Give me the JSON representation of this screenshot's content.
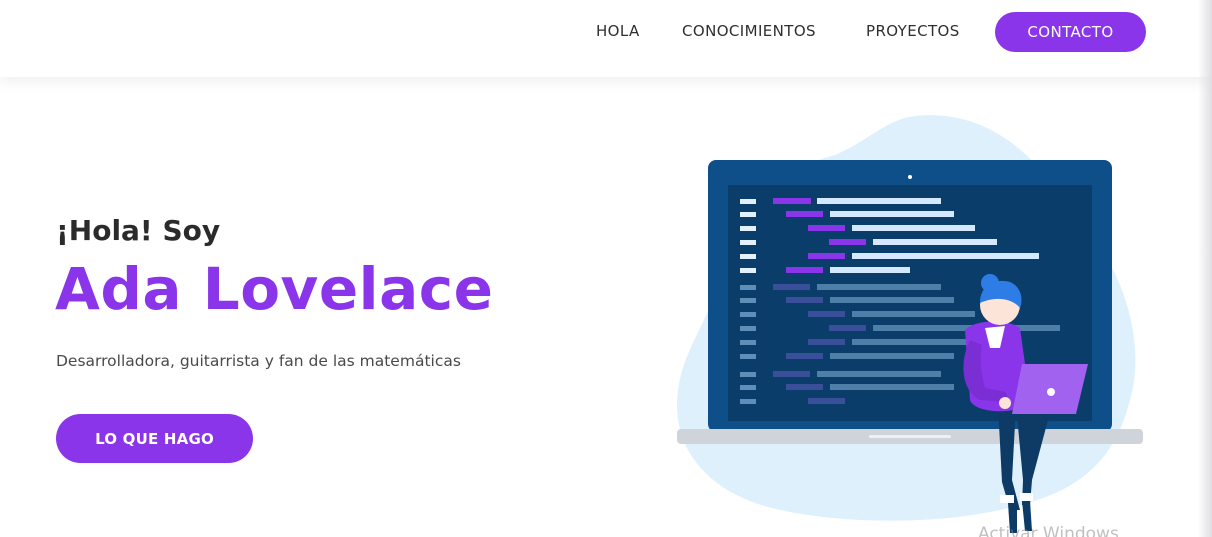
{
  "nav": {
    "links": [
      "HOLA",
      "CONOCIMIENTOS",
      "PROYECTOS"
    ],
    "cta_label": "CONTACTO"
  },
  "hero": {
    "greeting": "¡Hola! Soy",
    "name": "Ada Lovelace",
    "tagline": "Desarrolladora, guitarrista y fan de las matemáticas",
    "button_label": "LO QUE HAGO"
  },
  "illustration": {
    "icon": "developer-laptop-illustration"
  },
  "watermark": "Activar Windows",
  "colors": {
    "accent": "#8a35ea",
    "blob": "#dff0fd",
    "screen_frame": "#0e4f8a",
    "screen": "#0b3d6b"
  }
}
